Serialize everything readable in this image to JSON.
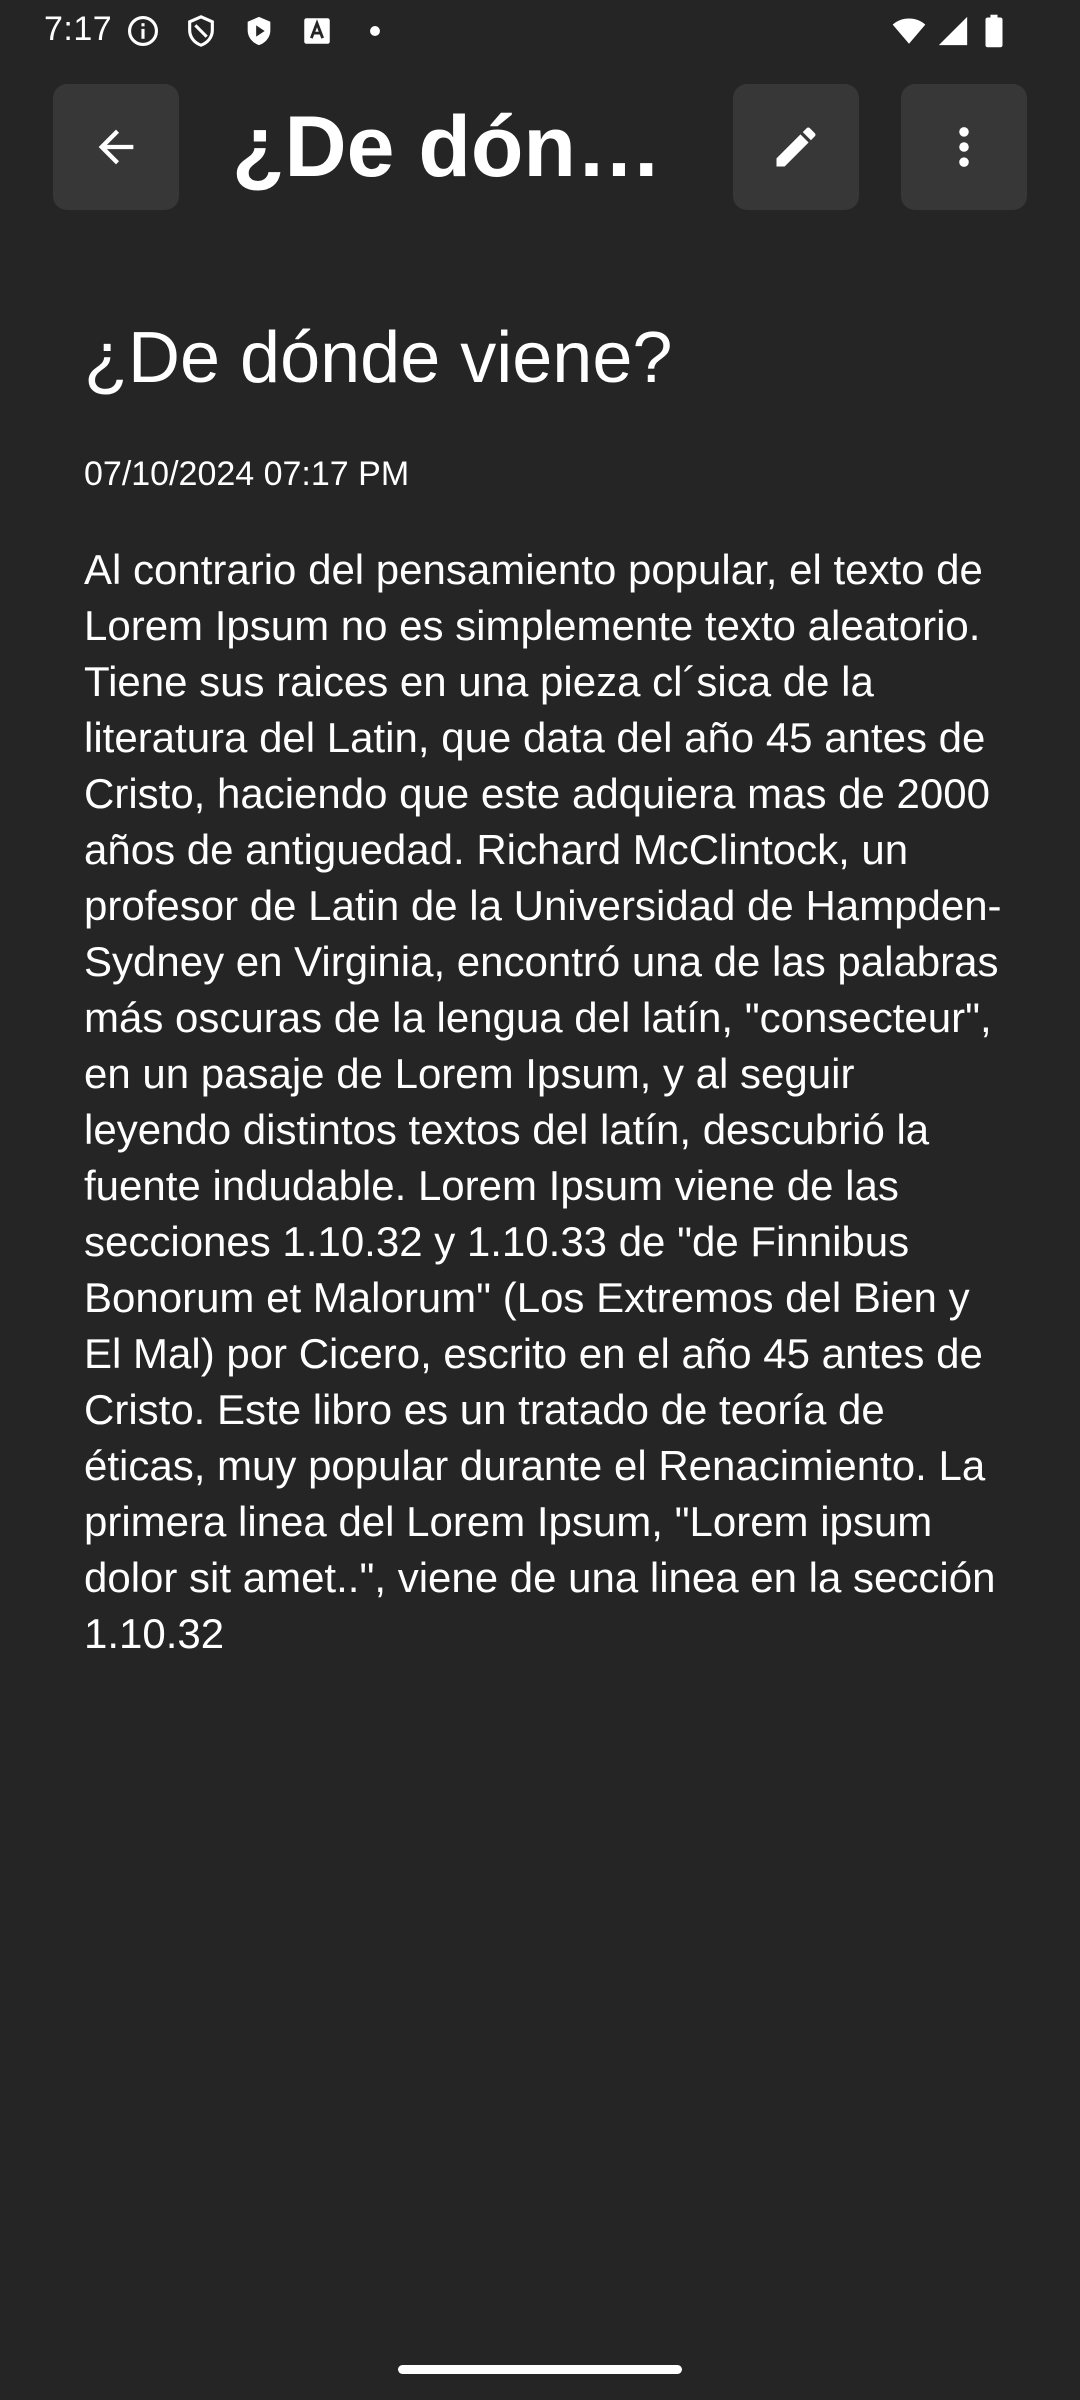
{
  "status_bar": {
    "time": "7:17",
    "icons": [
      "info-icon",
      "shield-icon",
      "play-protect-icon",
      "font-icon",
      "dot-icon",
      "wifi-icon",
      "signal-icon",
      "battery-icon"
    ]
  },
  "app_bar": {
    "title": "¿De dónde viene?",
    "back_icon": "arrow-back-icon",
    "edit_icon": "pencil-icon",
    "more_icon": "more-vert-icon"
  },
  "note": {
    "title": "¿De dónde viene?",
    "date": "07/10/2024 07:17 PM",
    "body": "Al contrario del pensamiento popular, el texto de Lorem Ipsum no es simplemente texto aleatorio. Tiene sus raices en una pieza cl´sica de la literatura del Latin, que data del año 45 antes de Cristo, haciendo que este adquiera mas de 2000 años de antiguedad. Richard McClintock, un profesor de Latin de la Universidad de Hampden-Sydney en Virginia, encontró una de las palabras más oscuras de la lengua del latín, \"consecteur\", en un pasaje de Lorem Ipsum, y al seguir leyendo distintos textos del latín, descubrió la fuente indudable. Lorem Ipsum viene de las secciones 1.10.32 y 1.10.33 de \"de Finnibus Bonorum et Malorum\" (Los Extremos del Bien y El Mal) por Cicero, escrito en el año 45 antes de Cristo. Este libro es un tratado de teoría de éticas, muy popular durante el Renacimiento. La primera linea del Lorem Ipsum, \"Lorem ipsum dolor sit amet..\", viene de una linea en la sección 1.10.32"
  },
  "colors": {
    "background": "#252525",
    "button_bg": "#373737",
    "text": "#ffffff"
  }
}
